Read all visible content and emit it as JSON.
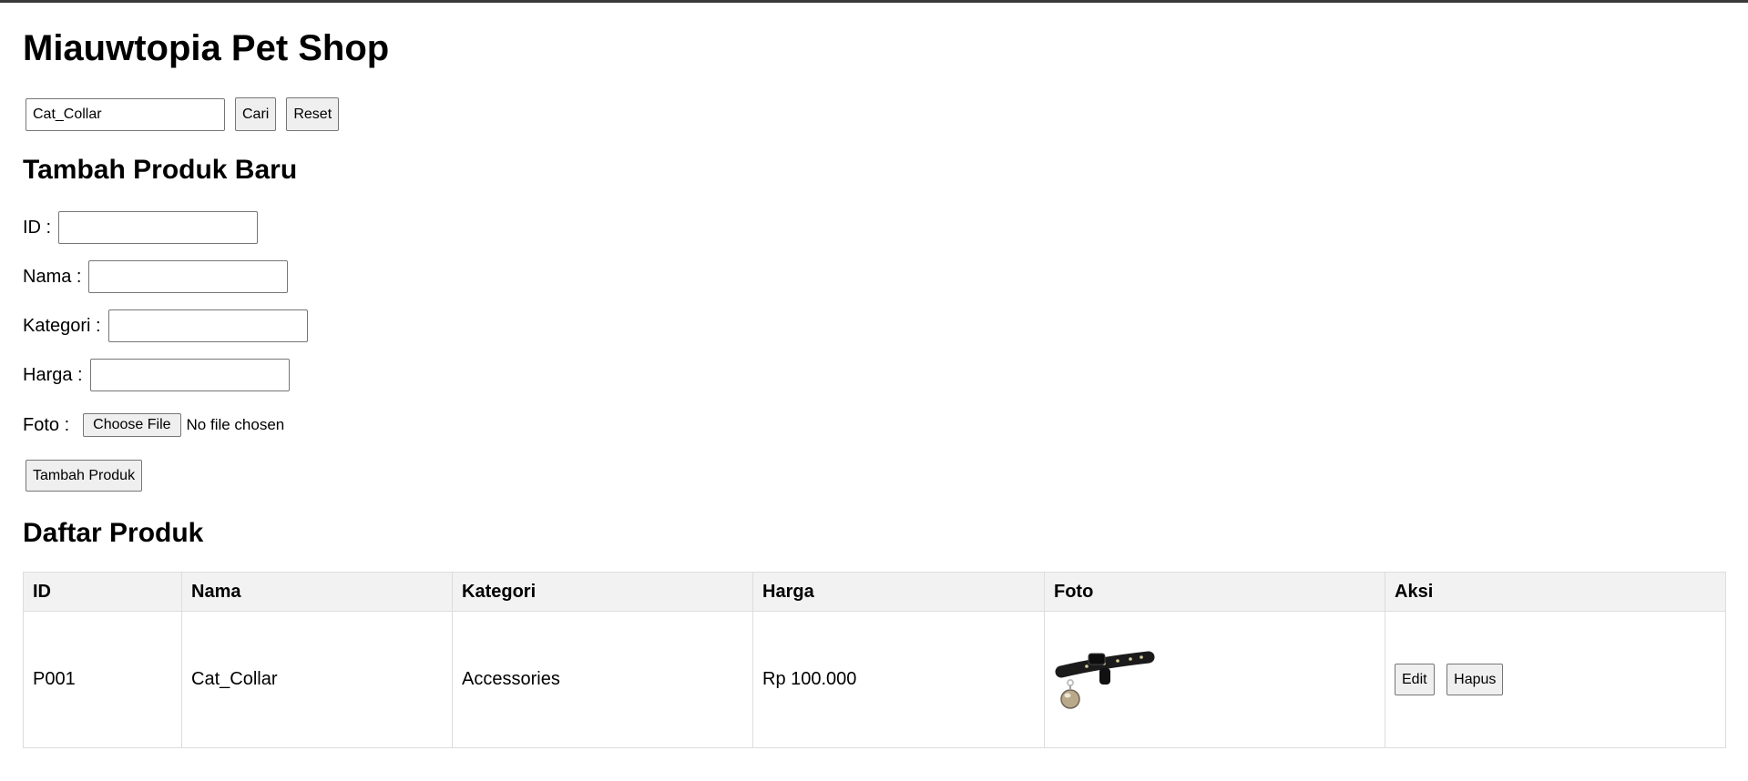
{
  "header": {
    "title": "Miauwtopia Pet Shop"
  },
  "search": {
    "value": "Cat_Collar",
    "search_label": "Cari",
    "reset_label": "Reset"
  },
  "add_form": {
    "heading": "Tambah Produk Baru",
    "id_label": "ID :",
    "name_label": "Nama :",
    "category_label": "Kategori :",
    "price_label": "Harga :",
    "photo_label": "Foto :",
    "choose_file_label": "Choose File",
    "file_status": "No file chosen",
    "submit_label": "Tambah Produk"
  },
  "product_list": {
    "heading": "Daftar Produk",
    "columns": [
      "ID",
      "Nama",
      "Kategori",
      "Harga",
      "Foto",
      "Aksi"
    ],
    "rows": [
      {
        "id": "P001",
        "name": "Cat_Collar",
        "category": "Accessories",
        "price": "Rp 100.000",
        "photo_icon": "cat-collar-photo",
        "edit_label": "Edit",
        "delete_label": "Hapus"
      }
    ]
  }
}
